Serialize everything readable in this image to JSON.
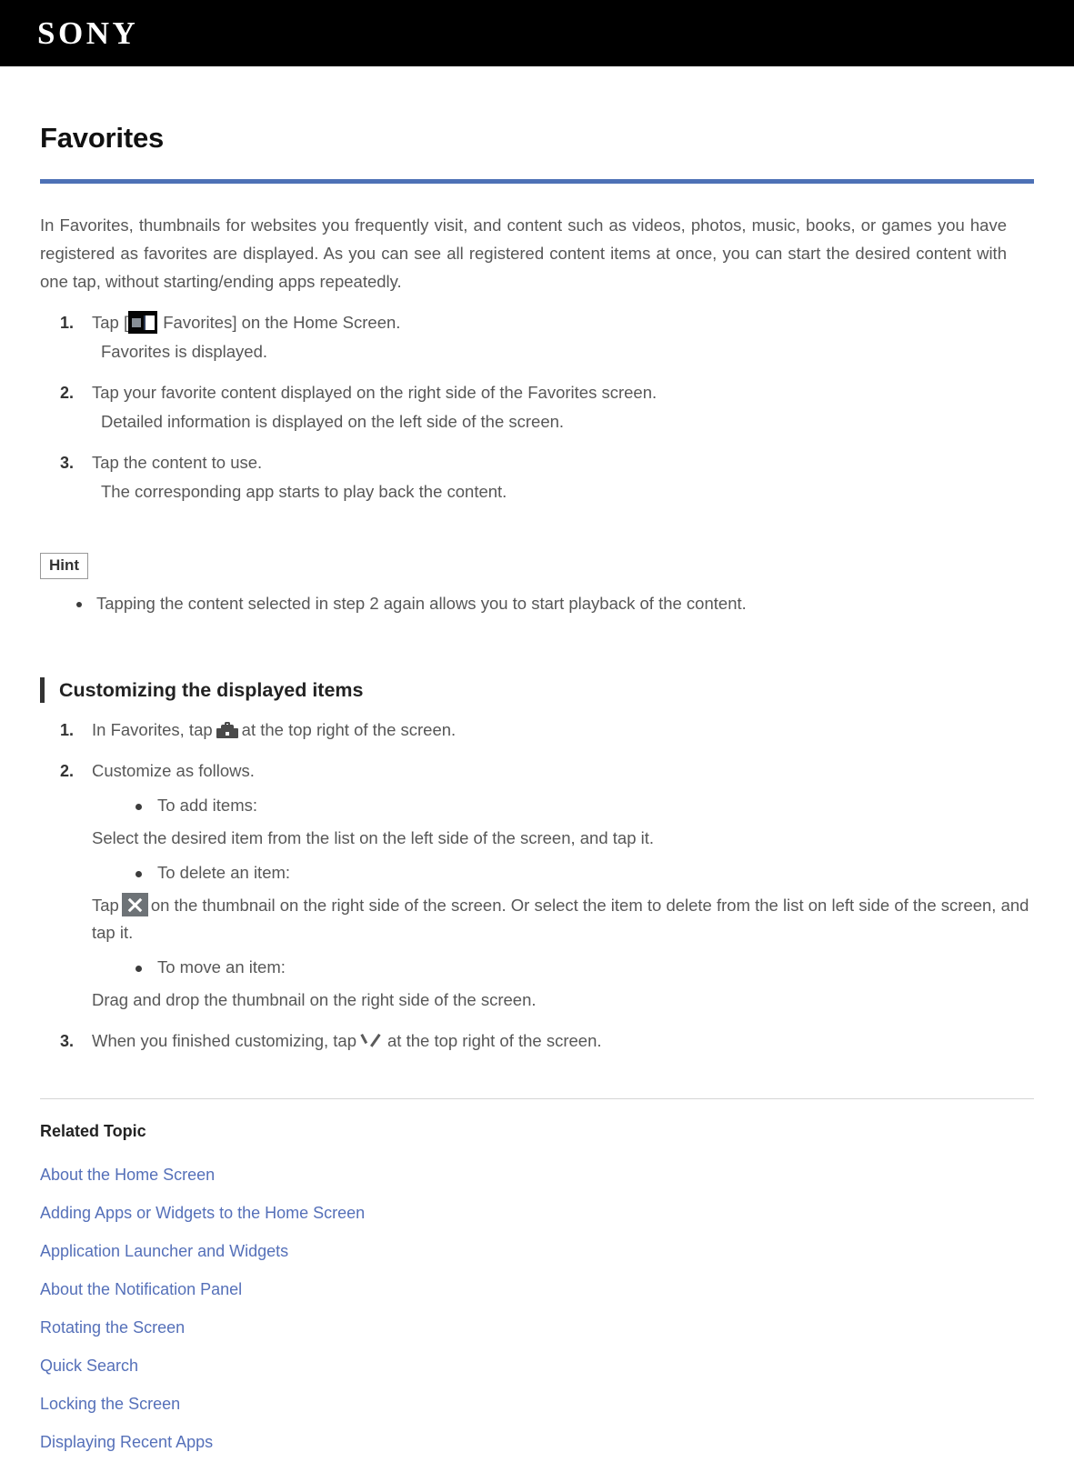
{
  "header": {
    "brand": "SONY",
    "brand_icon": "sony-logo"
  },
  "page": {
    "title": "Favorites",
    "intro": "In Favorites, thumbnails for websites you frequently visit, and content such as videos, photos, music, books, or games you have registered as favorites are displayed. As you can see all registered content items at once, you can start the desired content with one tap, without starting/ending apps repeatedly."
  },
  "steps": [
    {
      "num": "1.",
      "text_before": "Tap [",
      "icon": "favorites-icon",
      "text_after": " Favorites] on the Home Screen.",
      "result": "Favorites is displayed."
    },
    {
      "num": "2.",
      "text": "Tap your favorite content displayed on the right side of the Favorites screen.",
      "result": "Detailed information is displayed on the left side of the screen."
    },
    {
      "num": "3.",
      "text": "Tap the content to use.",
      "result": "The corresponding app starts to play back the content."
    }
  ],
  "hint": {
    "label": "Hint",
    "items": [
      "Tapping the content selected in step 2 again allows you to start playback of the content."
    ]
  },
  "section": {
    "heading": "Customizing the displayed items",
    "steps": [
      {
        "num": "1.",
        "text_before": "In Favorites, tap",
        "icon": "toolbox-icon",
        "text_after": "at the top right of the screen."
      },
      {
        "num": "2.",
        "text": "Customize as follows.",
        "bullets": [
          {
            "label": "To add items:",
            "body": "Select the desired item from the list on the left side of the screen, and tap it."
          },
          {
            "label": "To delete an item:",
            "body_before": "Tap",
            "icon": "close-x-icon",
            "body_after": "on the thumbnail on the right side of the screen. Or select the item to delete from the list on left side of the screen, and tap it."
          },
          {
            "label": "To move an item:",
            "body": "Drag and drop the thumbnail on the right side of the screen."
          }
        ]
      },
      {
        "num": "3.",
        "text_before": "When you finished customizing, tap",
        "icon": "check-icon",
        "text_after": "at the top right of the screen."
      }
    ]
  },
  "related": {
    "title": "Related Topic",
    "links": [
      "About the Home Screen",
      "Adding Apps or Widgets to the Home Screen",
      "Application Launcher and Widgets",
      "About the Notification Panel",
      "Rotating the Screen",
      "Quick Search",
      "Locking the Screen",
      "Displaying Recent Apps"
    ]
  },
  "colors": {
    "header_bg": "#000000",
    "title_rule": "#4d71b6",
    "link": "#5570b9",
    "body_text": "#575757"
  }
}
